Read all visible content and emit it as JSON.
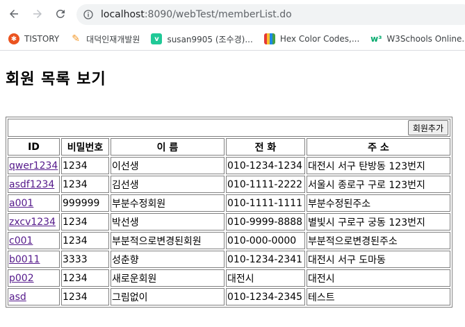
{
  "browser": {
    "url_host": "localhost",
    "url_rest": ":8090/webTest/memberList.do",
    "bookmarks": [
      {
        "label": "TISTORY",
        "icon": "tistory-icon",
        "color": "#eb531f"
      },
      {
        "label": "대덕인재개발원",
        "icon": "ddit-icon",
        "color": "#f39a2c"
      },
      {
        "label": "susan9905 (조수경)...",
        "icon": "velog-icon",
        "color": "#20c997"
      },
      {
        "label": "Hex Color Codes,...",
        "icon": "crayon-icon",
        "color": "#1a73e8"
      },
      {
        "label": "W3Schools Online...",
        "icon": "w3schools-icon",
        "color": "#04aa6d"
      }
    ]
  },
  "page": {
    "title": "회원 목록 보기",
    "add_button": "회원추가",
    "columns": [
      "ID",
      "비밀번호",
      "이 름",
      "전 화",
      "주 소"
    ],
    "rows": [
      {
        "id": "qwer1234",
        "pw": "1234",
        "name": "이선생",
        "tel": "010-1234-1234",
        "addr": "대전시 서구 탄방동 123번지"
      },
      {
        "id": "asdf1234",
        "pw": "1234",
        "name": "김선생",
        "tel": "010-1111-2222",
        "addr": "서울시 종로구 구로 123번지"
      },
      {
        "id": "a001",
        "pw": "999999",
        "name": "부분수정회원",
        "tel": "010-1111-1111",
        "addr": "부분수정된주소"
      },
      {
        "id": "zxcv1234",
        "pw": "1234",
        "name": "박선생",
        "tel": "010-9999-8888",
        "addr": "별빛시 구로구 궁동 123번지"
      },
      {
        "id": "c001",
        "pw": "1234",
        "name": "부분적으로변경된회원",
        "tel": "010-000-0000",
        "addr": "부분적으로변경된주소"
      },
      {
        "id": "b0011",
        "pw": "3333",
        "name": "성춘향",
        "tel": "010-1234-2341",
        "addr": "대전시 서구 도마동"
      },
      {
        "id": "p002",
        "pw": "1234",
        "name": "새로운회원",
        "tel": "대전시",
        "addr": "대전시"
      },
      {
        "id": "asd",
        "pw": "1234",
        "name": "그림없이",
        "tel": "010-1234-2345",
        "addr": "테스트"
      }
    ]
  }
}
